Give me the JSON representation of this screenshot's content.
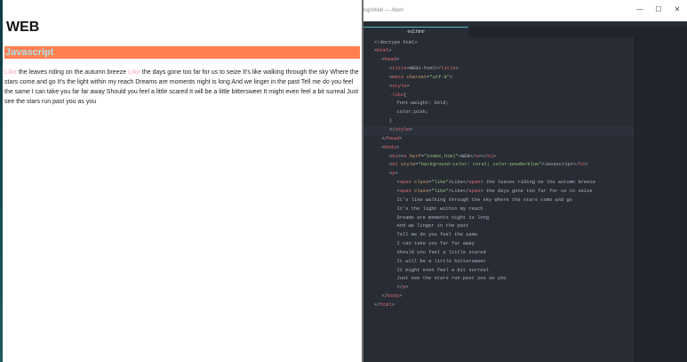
{
  "browser": {
    "heading": "WEB",
    "subheading": "Javascript",
    "paragraph": [
      {
        "text": "Like",
        "like": true
      },
      {
        "text": " the leaves riding on the autumn breeze ",
        "like": false
      },
      {
        "text": "Like",
        "like": true
      },
      {
        "text": " the days gone too far for us to seize It's like walking through the sky Where the stars come and go It's the light within my reach Dreams are moments night is long And we linger in the past Tell me do you feel the same I can take you far far away Should you feel a little scared It will be a little bittersweet It might even feel a bit surreal Just see the stars run past you as you",
        "like": false
      }
    ]
  },
  "editor": {
    "window_title": "top\\Web — Atom",
    "window_controls": {
      "minimize": "—",
      "maximize": "☐",
      "close": "✕"
    },
    "active_tab": "ex2.html",
    "colors": {
      "tag": "#e06c75",
      "attr": "#d19a66",
      "string": "#98c379",
      "text": "#abb2bf",
      "background": "#282c34"
    },
    "code_lines": [
      {
        "indent": 0,
        "tokens": [
          [
            "pun",
            "<!doctype html>"
          ]
        ]
      },
      {
        "indent": 0,
        "tokens": [
          [
            "pun",
            "<"
          ],
          [
            "tag",
            "html"
          ],
          [
            "pun",
            ">"
          ]
        ]
      },
      {
        "indent": 1,
        "tokens": [
          [
            "pun",
            "<"
          ],
          [
            "tag",
            "head"
          ],
          [
            "pun",
            ">"
          ]
        ]
      },
      {
        "indent": 2,
        "tokens": [
          [
            "pun",
            "<"
          ],
          [
            "tag",
            "title"
          ],
          [
            "pun",
            ">"
          ],
          [
            "txt",
            "WEB1-html"
          ],
          [
            "pun",
            "</"
          ],
          [
            "tag",
            "title"
          ],
          [
            "pun",
            ">"
          ]
        ]
      },
      {
        "indent": 2,
        "tokens": [
          [
            "pun",
            "<"
          ],
          [
            "tag",
            "meta"
          ],
          [
            "pun",
            " "
          ],
          [
            "attr",
            "charset"
          ],
          [
            "pun",
            "="
          ],
          [
            "str",
            "\"utf-8\""
          ],
          [
            "pun",
            ">"
          ]
        ]
      },
      {
        "indent": 2,
        "tokens": [
          [
            "pun",
            "<"
          ],
          [
            "tag",
            "style"
          ],
          [
            "pun",
            ">"
          ]
        ]
      },
      {
        "indent": 2,
        "tokens": [
          [
            "sel",
            ".like"
          ],
          [
            "pun",
            "{"
          ]
        ]
      },
      {
        "indent": 3,
        "tokens": [
          [
            "prop",
            "font-weight"
          ],
          [
            "pun",
            ": "
          ],
          [
            "val",
            "bold"
          ],
          [
            "pun",
            ";"
          ]
        ]
      },
      {
        "indent": 3,
        "tokens": [
          [
            "prop",
            "color"
          ],
          [
            "pun",
            ":"
          ],
          [
            "val",
            "pink"
          ],
          [
            "pun",
            ";"
          ]
        ]
      },
      {
        "indent": 2,
        "tokens": [
          [
            "pun",
            "}"
          ]
        ]
      },
      {
        "indent": 2,
        "tokens": [
          [
            "pun",
            "</"
          ],
          [
            "tag",
            "style"
          ],
          [
            "pun",
            ">"
          ]
        ],
        "cursor": true
      },
      {
        "indent": 1,
        "tokens": [
          [
            "pun",
            "</"
          ],
          [
            "tag",
            "head"
          ],
          [
            "pun",
            ">"
          ]
        ]
      },
      {
        "indent": 1,
        "tokens": [
          [
            "pun",
            "<"
          ],
          [
            "tag",
            "body"
          ],
          [
            "pun",
            ">"
          ]
        ]
      },
      {
        "indent": 2,
        "tokens": [
          [
            "pun",
            "<"
          ],
          [
            "tag",
            "h1"
          ],
          [
            "pun",
            ">"
          ],
          [
            "pun",
            "<"
          ],
          [
            "tag",
            "a"
          ],
          [
            "pun",
            " "
          ],
          [
            "attr",
            "herf"
          ],
          [
            "pun",
            "="
          ],
          [
            "str",
            "\"index,html\""
          ],
          [
            "pun",
            ">"
          ],
          [
            "txt",
            "WEB"
          ],
          [
            "pun",
            "</"
          ],
          [
            "tag",
            "a"
          ],
          [
            "pun",
            ">"
          ],
          [
            "pun",
            "</"
          ],
          [
            "tag",
            "h1"
          ],
          [
            "pun",
            ">"
          ]
        ]
      },
      {
        "indent": 2,
        "tokens": [
          [
            "pun",
            "<"
          ],
          [
            "tag",
            "h2"
          ],
          [
            "pun",
            " "
          ],
          [
            "attr",
            "style"
          ],
          [
            "pun",
            "="
          ],
          [
            "str",
            "\"background-color: coral; color:powderblue\""
          ],
          [
            "pun",
            ">"
          ],
          [
            "txt",
            "Javascript"
          ],
          [
            "pun",
            "</"
          ],
          [
            "tag",
            "h2"
          ],
          [
            "pun",
            ">"
          ]
        ]
      },
      {
        "indent": 2,
        "tokens": [
          [
            "pun",
            "<"
          ],
          [
            "tag",
            "p"
          ],
          [
            "pun",
            ">"
          ]
        ]
      },
      {
        "indent": 3,
        "tokens": [
          [
            "pun",
            "<"
          ],
          [
            "tag",
            "span"
          ],
          [
            "pun",
            " "
          ],
          [
            "attr",
            "class"
          ],
          [
            "pun",
            "="
          ],
          [
            "str",
            "\"like\""
          ],
          [
            "pun",
            ">"
          ],
          [
            "txt",
            "Like"
          ],
          [
            "pun",
            "</"
          ],
          [
            "tag",
            "span"
          ],
          [
            "pun",
            ">"
          ],
          [
            "txt",
            " the leaves riding on the autumn breeze"
          ]
        ]
      },
      {
        "indent": 3,
        "tokens": [
          [
            "pun",
            "<"
          ],
          [
            "tag",
            "span"
          ],
          [
            "pun",
            " "
          ],
          [
            "attr",
            "class"
          ],
          [
            "pun",
            "="
          ],
          [
            "str",
            "\"like\""
          ],
          [
            "pun",
            ">"
          ],
          [
            "txt",
            "Like"
          ],
          [
            "pun",
            "</"
          ],
          [
            "tag",
            "span"
          ],
          [
            "pun",
            ">"
          ],
          [
            "txt",
            " the days gone too far for us to seize"
          ]
        ]
      },
      {
        "indent": 3,
        "tokens": [
          [
            "txt",
            "It's like walking through the sky Where the stars come and go"
          ]
        ]
      },
      {
        "indent": 3,
        "tokens": [
          [
            "txt",
            "It's the light within my reach"
          ]
        ]
      },
      {
        "indent": 3,
        "tokens": [
          [
            "txt",
            "Dreams are moments night is long"
          ]
        ]
      },
      {
        "indent": 3,
        "tokens": [
          [
            "txt",
            "And we linger in the past"
          ]
        ]
      },
      {
        "indent": 3,
        "tokens": [
          [
            "txt",
            "Tell me do you feel the same"
          ]
        ]
      },
      {
        "indent": 3,
        "tokens": [
          [
            "txt",
            "I can take you far far away"
          ]
        ]
      },
      {
        "indent": 3,
        "tokens": [
          [
            "txt",
            "Should you feel a little scared"
          ]
        ]
      },
      {
        "indent": 3,
        "tokens": [
          [
            "txt",
            "It will be a little bittersweet"
          ]
        ]
      },
      {
        "indent": 3,
        "tokens": [
          [
            "txt",
            "It might even feel a bit surreal"
          ]
        ]
      },
      {
        "indent": 3,
        "tokens": [
          [
            "txt",
            "Just see the stars run past you as you"
          ]
        ]
      },
      {
        "indent": 3,
        "tokens": [
          [
            "pun",
            "</"
          ],
          [
            "tag",
            "p"
          ],
          [
            "pun",
            ">"
          ]
        ]
      },
      {
        "indent": 1,
        "tokens": [
          [
            "pun",
            "</"
          ],
          [
            "tag",
            "body"
          ],
          [
            "pun",
            ">"
          ]
        ]
      },
      {
        "indent": 0,
        "tokens": [
          [
            "pun",
            "</"
          ],
          [
            "tag",
            "html"
          ],
          [
            "pun",
            ">"
          ]
        ]
      }
    ]
  }
}
